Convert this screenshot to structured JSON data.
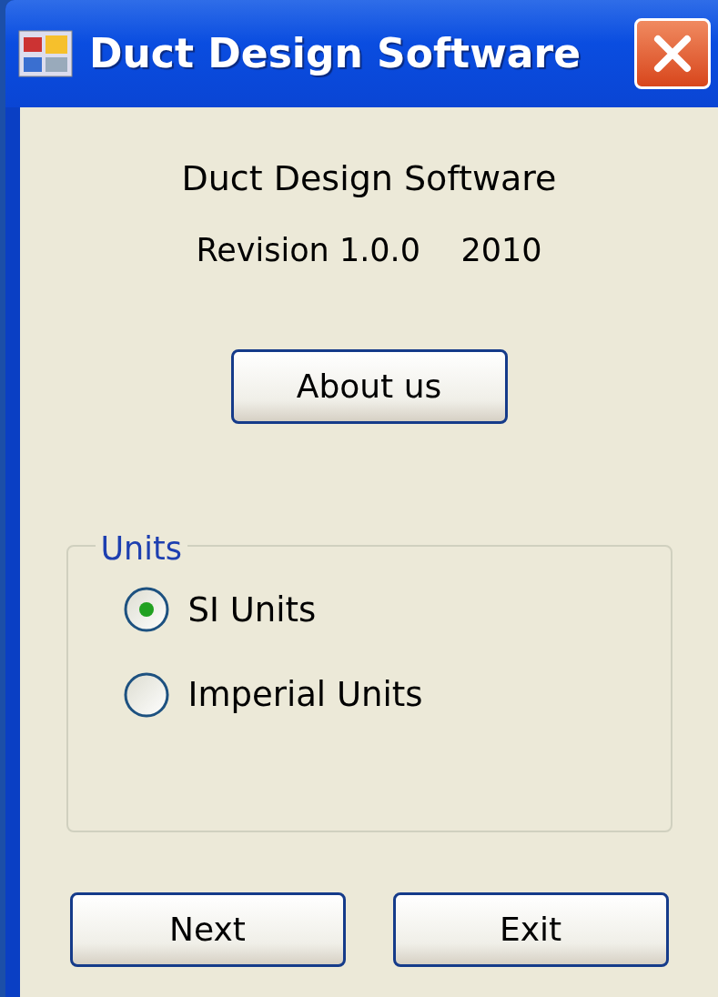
{
  "window": {
    "title": "Duct Design Software"
  },
  "heading": "Duct Design Software",
  "revision": "Revision 1.0.0    2010",
  "about_button": "About us",
  "units": {
    "legend": "Units",
    "options": [
      {
        "label": "SI Units",
        "selected": true
      },
      {
        "label": "Imperial Units",
        "selected": false
      }
    ]
  },
  "buttons": [
    "Next",
    "Exit"
  ]
}
